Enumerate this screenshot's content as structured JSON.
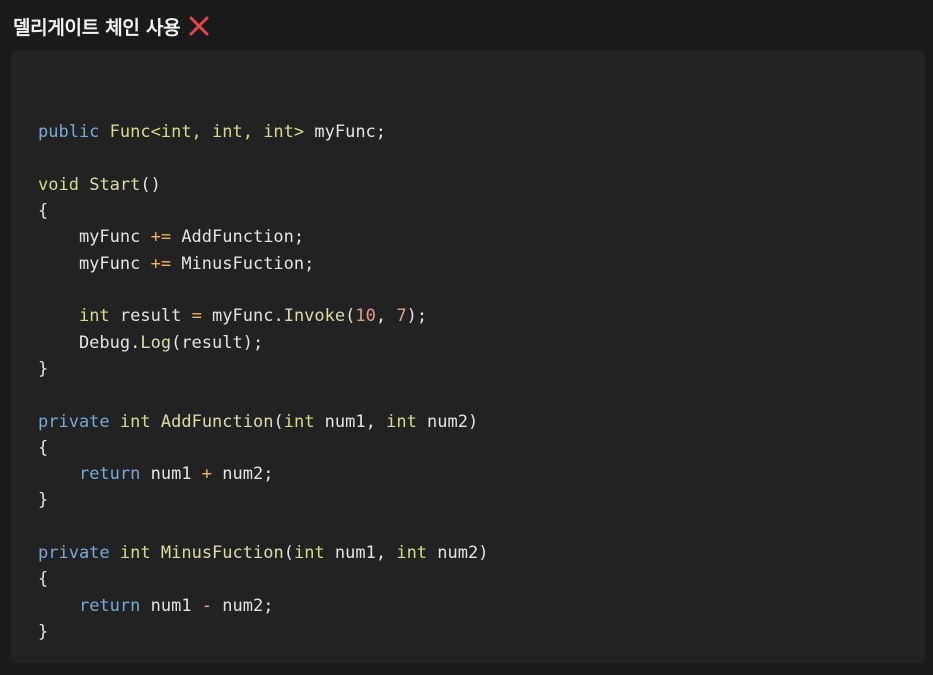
{
  "header": {
    "title": "델리게이트 체인 사용",
    "status_icon": "close-icon",
    "status_color": "#e8434a"
  },
  "colors": {
    "background": "#1a1a1a",
    "panel": "#222222",
    "keyword": "#7aa8d6",
    "type": "#d7dc8a",
    "function": "#dcdcaa",
    "number": "#e69a8d",
    "operator": "#f0b75a",
    "text": "#e3e3e3"
  },
  "code": {
    "language": "C#",
    "lines": [
      [],
      [
        {
          "t": "public",
          "k": "keyword"
        },
        {
          "t": " ",
          "k": "plain"
        },
        {
          "t": "Func<int, int, int>",
          "k": "type"
        },
        {
          "t": " myFunc;",
          "k": "plain"
        }
      ],
      [],
      [
        {
          "t": "void",
          "k": "type"
        },
        {
          "t": " ",
          "k": "plain"
        },
        {
          "t": "Start",
          "k": "func"
        },
        {
          "t": "()",
          "k": "plain"
        }
      ],
      [
        {
          "t": "{",
          "k": "plain"
        }
      ],
      [
        {
          "t": "    myFunc ",
          "k": "plain"
        },
        {
          "t": "+=",
          "k": "operator"
        },
        {
          "t": " AddFunction;",
          "k": "plain"
        }
      ],
      [
        {
          "t": "    myFunc ",
          "k": "plain"
        },
        {
          "t": "+=",
          "k": "operator"
        },
        {
          "t": " MinusFuction;",
          "k": "plain"
        }
      ],
      [],
      [
        {
          "t": "    ",
          "k": "plain"
        },
        {
          "t": "int",
          "k": "type"
        },
        {
          "t": " result ",
          "k": "plain"
        },
        {
          "t": "=",
          "k": "operator"
        },
        {
          "t": " myFunc.",
          "k": "plain"
        },
        {
          "t": "Invoke",
          "k": "func"
        },
        {
          "t": "(",
          "k": "plain"
        },
        {
          "t": "10",
          "k": "number"
        },
        {
          "t": ", ",
          "k": "plain"
        },
        {
          "t": "7",
          "k": "number"
        },
        {
          "t": ");",
          "k": "plain"
        }
      ],
      [
        {
          "t": "    Debug.",
          "k": "plain"
        },
        {
          "t": "Log",
          "k": "func"
        },
        {
          "t": "(result);",
          "k": "plain"
        }
      ],
      [
        {
          "t": "}",
          "k": "plain"
        }
      ],
      [],
      [
        {
          "t": "private",
          "k": "keyword"
        },
        {
          "t": " ",
          "k": "plain"
        },
        {
          "t": "int",
          "k": "type"
        },
        {
          "t": " ",
          "k": "plain"
        },
        {
          "t": "AddFunction",
          "k": "func"
        },
        {
          "t": "(",
          "k": "plain"
        },
        {
          "t": "int",
          "k": "type"
        },
        {
          "t": " num1, ",
          "k": "plain"
        },
        {
          "t": "int",
          "k": "type"
        },
        {
          "t": " num2)",
          "k": "plain"
        }
      ],
      [
        {
          "t": "{",
          "k": "plain"
        }
      ],
      [
        {
          "t": "    ",
          "k": "plain"
        },
        {
          "t": "return",
          "k": "keyword"
        },
        {
          "t": " num1 ",
          "k": "plain"
        },
        {
          "t": "+",
          "k": "operator"
        },
        {
          "t": " num2;",
          "k": "plain"
        }
      ],
      [
        {
          "t": "}",
          "k": "plain"
        }
      ],
      [],
      [
        {
          "t": "private",
          "k": "keyword"
        },
        {
          "t": " ",
          "k": "plain"
        },
        {
          "t": "int",
          "k": "type"
        },
        {
          "t": " ",
          "k": "plain"
        },
        {
          "t": "MinusFuction",
          "k": "func"
        },
        {
          "t": "(",
          "k": "plain"
        },
        {
          "t": "int",
          "k": "type"
        },
        {
          "t": " num1, ",
          "k": "plain"
        },
        {
          "t": "int",
          "k": "type"
        },
        {
          "t": " num2)",
          "k": "plain"
        }
      ],
      [
        {
          "t": "{",
          "k": "plain"
        }
      ],
      [
        {
          "t": "    ",
          "k": "plain"
        },
        {
          "t": "return",
          "k": "keyword"
        },
        {
          "t": " num1 ",
          "k": "plain"
        },
        {
          "t": "-",
          "k": "operator"
        },
        {
          "t": " num2;",
          "k": "plain"
        }
      ],
      [
        {
          "t": "}",
          "k": "plain"
        }
      ]
    ]
  }
}
